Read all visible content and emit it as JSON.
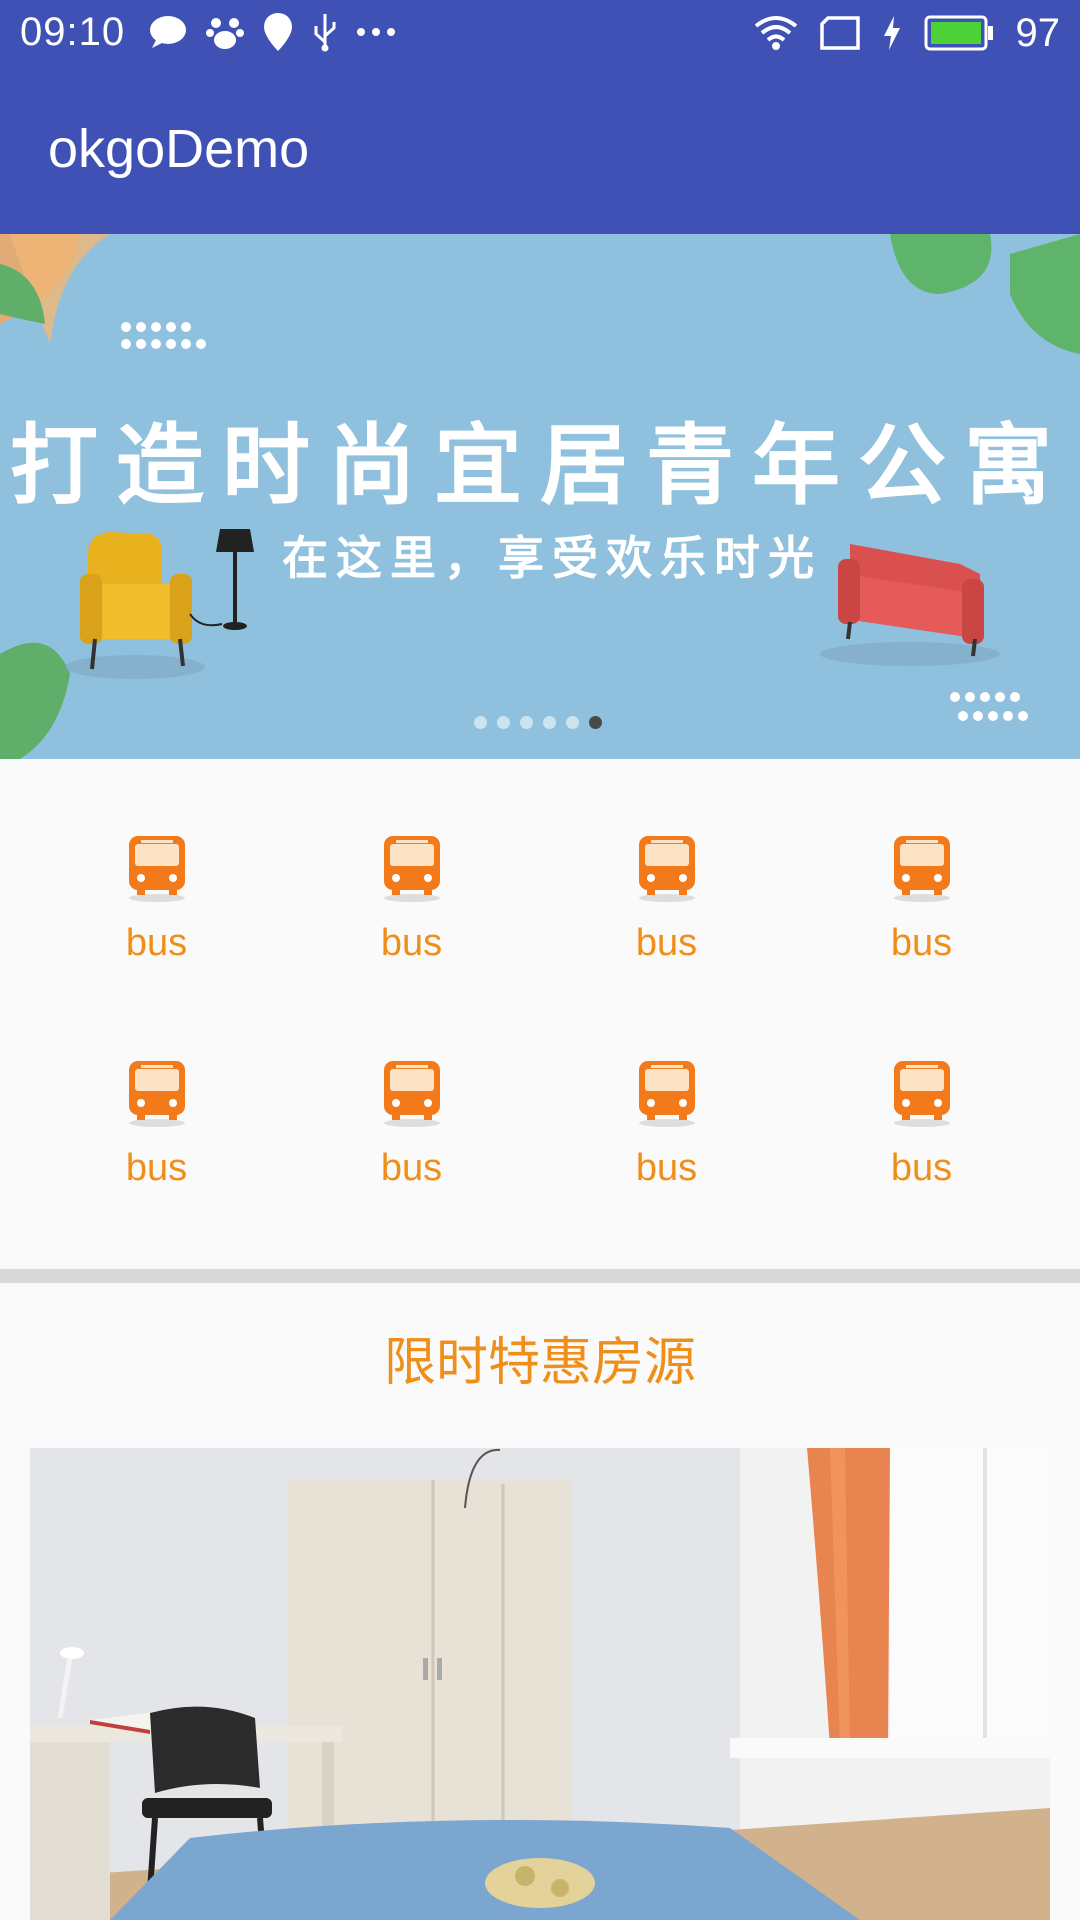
{
  "status_bar": {
    "time": "09:10",
    "battery_level": "97",
    "left_icons": [
      "chat-icon",
      "baidu-paw-icon",
      "du-location-icon",
      "usb-icon",
      "more-dots-icon"
    ],
    "right_icons": [
      "wifi-icon",
      "sim-icon",
      "charging-icon",
      "battery-icon"
    ],
    "battery_color": "#4cd137"
  },
  "app_bar": {
    "title": "okgoDemo",
    "color": "#3f51b5"
  },
  "banner": {
    "title": "打造时尚宜居青年公寓",
    "subtitle": "在这里，享受欢乐时光",
    "page_count": 6,
    "active_index": 5
  },
  "grid": {
    "items": [
      {
        "label": "bus",
        "icon": "bus-icon"
      },
      {
        "label": "bus",
        "icon": "bus-icon"
      },
      {
        "label": "bus",
        "icon": "bus-icon"
      },
      {
        "label": "bus",
        "icon": "bus-icon"
      },
      {
        "label": "bus",
        "icon": "bus-icon"
      },
      {
        "label": "bus",
        "icon": "bus-icon"
      },
      {
        "label": "bus",
        "icon": "bus-icon"
      },
      {
        "label": "bus",
        "icon": "bus-icon"
      }
    ],
    "accent_color": "#f08e1a"
  },
  "section": {
    "title": "限时特惠房源"
  }
}
